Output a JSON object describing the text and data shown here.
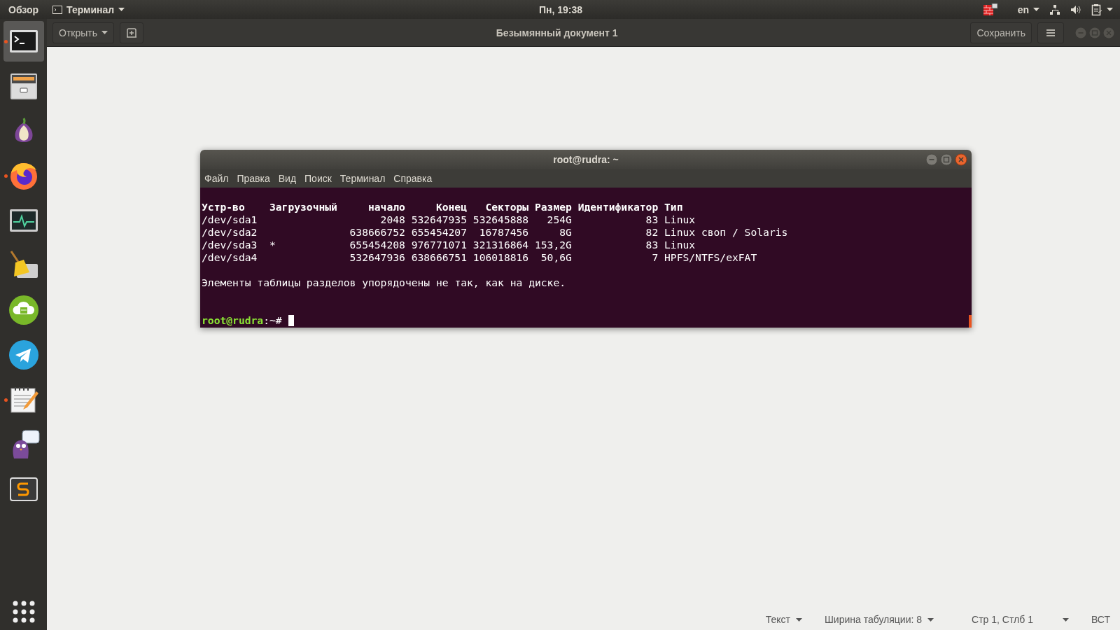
{
  "top_bar": {
    "activities": "Обзор",
    "app_menu": "Терминал",
    "clock": "Пн, 19:38",
    "keyboard_layout": "en"
  },
  "dock": {
    "items": [
      {
        "kind": "terminal",
        "selected": true,
        "running": true
      },
      {
        "kind": "files",
        "selected": false,
        "running": false
      },
      {
        "kind": "onion",
        "selected": false,
        "running": false
      },
      {
        "kind": "browser",
        "selected": false,
        "running": true
      },
      {
        "kind": "monitor",
        "selected": false,
        "running": false
      },
      {
        "kind": "cleaner",
        "selected": false,
        "running": false
      },
      {
        "kind": "cloud",
        "selected": false,
        "running": false
      },
      {
        "kind": "messenger",
        "selected": false,
        "running": false
      },
      {
        "kind": "notepad",
        "selected": false,
        "running": true
      },
      {
        "kind": "chat",
        "selected": false,
        "running": false
      },
      {
        "kind": "sublime",
        "selected": false,
        "running": false
      }
    ]
  },
  "editor": {
    "open_button": "Открыть",
    "title": "Безымянный документ 1",
    "save_button": "Сохранить",
    "status_bar": {
      "language": "Текст",
      "tab_width": "Ширина табуляции: 8",
      "position": "Стр 1, Стлб 1",
      "mode": "ВСТ"
    }
  },
  "terminal": {
    "title": "root@rudra: ~",
    "menu": [
      "Файл",
      "Правка",
      "Вид",
      "Поиск",
      "Терминал",
      "Справка"
    ],
    "columns": [
      "Устр-во",
      "Загрузочный",
      "начало",
      "Конец",
      "Секторы",
      "Размер",
      "Идентификатор",
      "Тип"
    ],
    "rows": [
      {
        "device": "/dev/sda1",
        "start": "2048",
        "end": "532647935",
        "sectors": "532645888",
        "size": "254G",
        "id": "83",
        "type": "Linux"
      },
      {
        "device": "/dev/sda2",
        "start": "638666752",
        "end": "655454207",
        "sectors": "16787456",
        "size": "8G",
        "id": "82",
        "type": "Linux своп / Solaris"
      },
      {
        "device": "/dev/sda3",
        "boot": "*",
        "start": "655454208",
        "end": "976771071",
        "sectors": "321316864",
        "size": "153,2G",
        "id": "83",
        "type": "Linux"
      },
      {
        "device": "/dev/sda4",
        "start": "532647936",
        "end": "638666751",
        "sectors": "106018816",
        "size": "50,6G",
        "id": "7",
        "type": "HPFS/NTFS/exFAT"
      }
    ],
    "message": "Элементы таблицы разделов упорядочены не так, как на диске.",
    "prompt_user": "root@rudra",
    "prompt_rest": ":~#"
  }
}
